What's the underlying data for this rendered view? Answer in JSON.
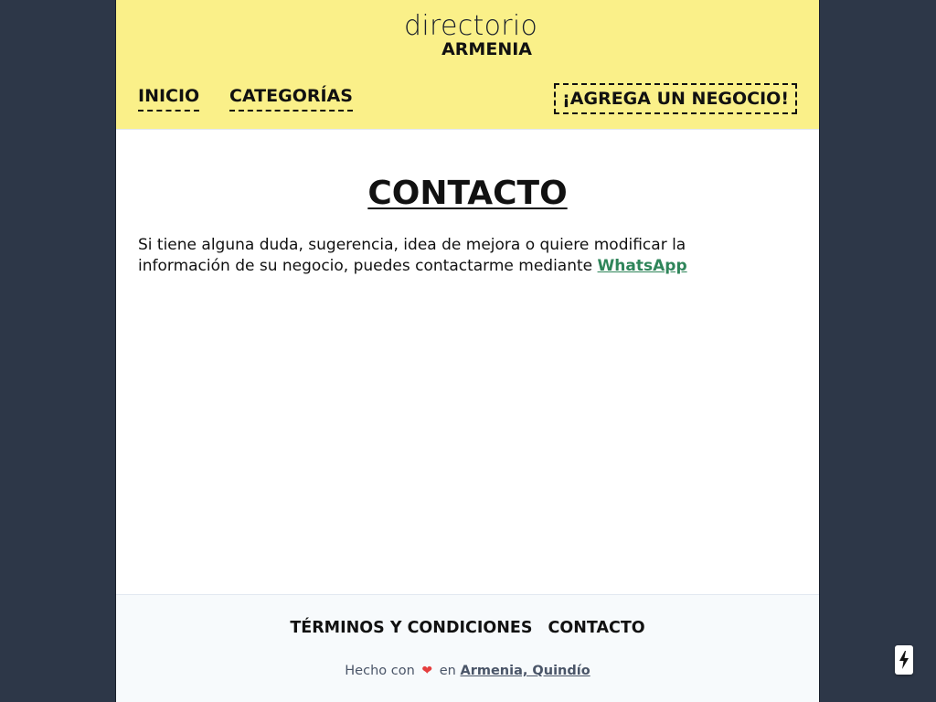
{
  "header": {
    "logo_top": "directorio",
    "logo_bottom": "ARMENIA",
    "nav": [
      {
        "label": "INICIO"
      },
      {
        "label": "CATEGORÍAS"
      }
    ],
    "add_button": "¡AGREGA UN NEGOCIO!"
  },
  "main": {
    "title": "CONTACTO",
    "paragraph": "Si tiene alguna duda, sugerencia, idea de mejora o quiere modificar la información de su negocio, puedes contactarme mediante",
    "link_label": "WhatsApp"
  },
  "footer": {
    "links": [
      {
        "label": "TÉRMINOS Y CONDICIONES"
      },
      {
        "label": "CONTACTO"
      }
    ],
    "made_with": "Hecho con",
    "heart": "❤",
    "made_in": "en",
    "place": "Armenia, Quindío"
  },
  "floating": {
    "icon": "lightning-bolt-icon"
  },
  "colors": {
    "header_bg": "#faf089",
    "outer_bg": "#2d3748",
    "link_green": "#2f855a",
    "footer_bg": "#f7fafc"
  }
}
